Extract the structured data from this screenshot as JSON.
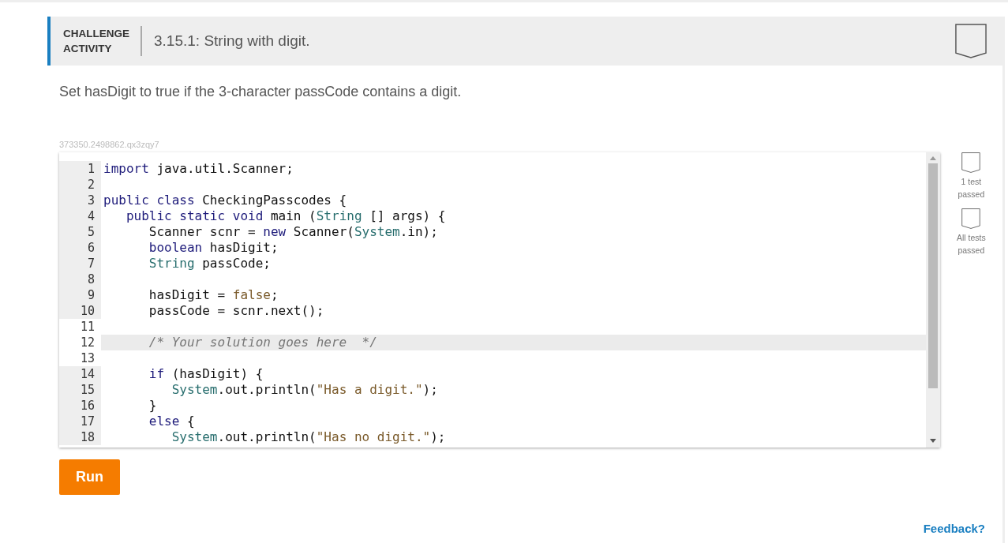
{
  "header": {
    "label_lines": [
      "CHALLENGE",
      "ACTIVITY"
    ],
    "title": "3.15.1: String with digit."
  },
  "instructions": "Set hasDigit to true if the 3-character passCode contains a digit.",
  "activity_id": "373350.2498862.qx3zqy7",
  "editor": {
    "lines": [
      {
        "number": "1",
        "editable": false,
        "active": false,
        "tokens": [
          {
            "kind": "keyword",
            "text": "import"
          },
          {
            "kind": "plain",
            "text": " java.util.Scanner;"
          }
        ]
      },
      {
        "number": "2",
        "editable": false,
        "active": false
      },
      {
        "number": "3",
        "editable": false,
        "active": false,
        "tokens": [
          {
            "kind": "keyword",
            "text": "public class"
          },
          {
            "kind": "plain",
            "text": " CheckingPasscodes {"
          }
        ]
      },
      {
        "number": "4",
        "editable": false,
        "active": false,
        "tokens": [
          {
            "kind": "keyword",
            "text": "   public static void"
          },
          {
            "kind": "plain",
            "text": " main ("
          },
          {
            "kind": "type",
            "text": "String"
          },
          {
            "kind": "plain",
            "text": " [] args) {"
          }
        ]
      },
      {
        "number": "5",
        "editable": false,
        "active": false,
        "tokens": [
          {
            "kind": "plain",
            "text": "      Scanner scnr = "
          },
          {
            "kind": "keyword",
            "text": "new"
          },
          {
            "kind": "plain",
            "text": " Scanner("
          },
          {
            "kind": "type",
            "text": "System"
          },
          {
            "kind": "plain",
            "text": ".in);"
          }
        ]
      },
      {
        "number": "6",
        "editable": false,
        "active": false,
        "tokens": [
          {
            "kind": "keyword",
            "text": "      boolean"
          },
          {
            "kind": "plain",
            "text": " hasDigit;"
          }
        ]
      },
      {
        "number": "7",
        "editable": false,
        "active": false,
        "tokens": [
          {
            "kind": "type",
            "text": "      String"
          },
          {
            "kind": "plain",
            "text": " passCode;"
          }
        ]
      },
      {
        "number": "8",
        "editable": false,
        "active": false
      },
      {
        "number": "9",
        "editable": false,
        "active": false,
        "tokens": [
          {
            "kind": "plain",
            "text": "      hasDigit = "
          },
          {
            "kind": "string",
            "text": "false"
          },
          {
            "kind": "plain",
            "text": ";"
          }
        ]
      },
      {
        "number": "10",
        "editable": false,
        "active": false,
        "tokens": [
          {
            "kind": "plain",
            "text": "      passCode = scnr.next();"
          }
        ]
      },
      {
        "number": "11",
        "editable": true,
        "active": false
      },
      {
        "number": "12",
        "editable": true,
        "active": true,
        "tokens": [
          {
            "kind": "comment",
            "text": "      /* Your solution goes here  */"
          }
        ]
      },
      {
        "number": "13",
        "editable": true,
        "active": false
      },
      {
        "number": "14",
        "editable": false,
        "active": false,
        "tokens": [
          {
            "kind": "keyword",
            "text": "      if"
          },
          {
            "kind": "plain",
            "text": " (hasDigit) {"
          }
        ]
      },
      {
        "number": "15",
        "editable": false,
        "active": false,
        "tokens": [
          {
            "kind": "type",
            "text": "         System"
          },
          {
            "kind": "plain",
            "text": ".out.println("
          },
          {
            "kind": "string",
            "text": "\"Has a digit.\""
          },
          {
            "kind": "plain",
            "text": ");"
          }
        ]
      },
      {
        "number": "16",
        "editable": false,
        "active": false,
        "tokens": [
          {
            "kind": "plain",
            "text": "      }"
          }
        ]
      },
      {
        "number": "17",
        "editable": false,
        "active": false,
        "tokens": [
          {
            "kind": "keyword",
            "text": "      else"
          },
          {
            "kind": "plain",
            "text": " {"
          }
        ]
      },
      {
        "number": "18",
        "editable": false,
        "active": false,
        "tokens": [
          {
            "kind": "type",
            "text": "         System"
          },
          {
            "kind": "plain",
            "text": ".out.println("
          },
          {
            "kind": "string",
            "text": "\"Has no digit.\""
          },
          {
            "kind": "plain",
            "text": ");"
          }
        ]
      }
    ]
  },
  "tests": [
    {
      "lines": [
        "1 test",
        "passed"
      ],
      "passed": false
    },
    {
      "lines": [
        "All tests",
        "passed"
      ],
      "passed": false
    }
  ],
  "run_button": "Run",
  "feedback_link": "Feedback?"
}
